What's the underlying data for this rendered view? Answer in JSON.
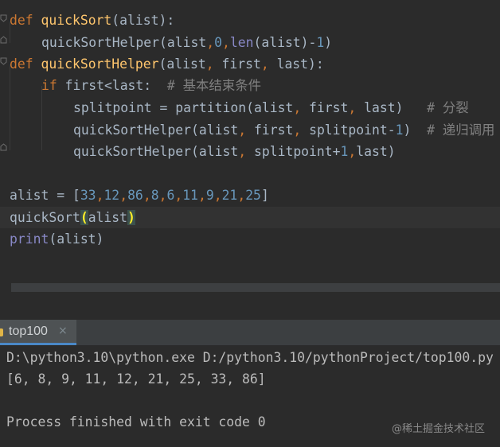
{
  "editor": {
    "line1": {
      "kw": "def",
      "fname": "quickSort",
      "rest": "(alist):"
    },
    "line2": {
      "a": "quickSortHelper(alist",
      "c1": ",",
      "n0": "0",
      "c2": ",",
      "fn": "len",
      "b": "(alist)-",
      "n1": "1",
      "c": ")"
    },
    "line3": {
      "kw": "def",
      "fname": "quickSortHelper",
      "a": "(alist",
      "c1": ",",
      "b": " first",
      "c2": ",",
      "c": " last):"
    },
    "line4": {
      "kw": "if",
      "a": " first<last:  ",
      "cmt": "# 基本结束条件"
    },
    "line5": {
      "a": "splitpoint = partition(alist",
      "c1": ",",
      "b": " first",
      "c2": ",",
      "c": " last)   ",
      "cmt": "# 分裂"
    },
    "line6": {
      "a": "quickSortHelper(alist",
      "c1": ",",
      "b": " first",
      "c2": ",",
      "c": " splitpoint-",
      "n": "1",
      "d": ")  ",
      "cmt": "# 递归调用"
    },
    "line7": {
      "a": "quickSortHelper(alist",
      "c1": ",",
      "b": " splitpoint+",
      "n": "1",
      "c2": ",",
      "c": "last)"
    },
    "line9": {
      "a": "alist = [",
      "nums": [
        "33",
        "12",
        "86",
        "8",
        "6",
        "11",
        "9",
        "21",
        "25"
      ],
      "last": "25",
      "sep": ",",
      "close": "]"
    },
    "line10": {
      "a": "quickSort",
      "p1": "(",
      "b": "alist",
      "p2": ")"
    },
    "line11": {
      "fn": "print",
      "a": "(alist)"
    }
  },
  "run_tab": {
    "label": "top100",
    "close_glyph": "×"
  },
  "console": {
    "command": "D:\\python3.10\\python.exe D:/python3.10/pythonProject/top100.py",
    "output": "[6, 8, 9, 11, 12, 21, 25, 33, 86]",
    "exit": "Process finished with exit code 0"
  },
  "watermark": "@稀土掘金技术社区",
  "colors": {
    "background": "#2b2b2b",
    "keyword": "#cc7832",
    "function_def": "#ffc66d",
    "number": "#6897bb",
    "builtin": "#8888c6",
    "comment": "#808080",
    "text": "#a9b7c6",
    "tab_accent": "#4a88c7"
  }
}
